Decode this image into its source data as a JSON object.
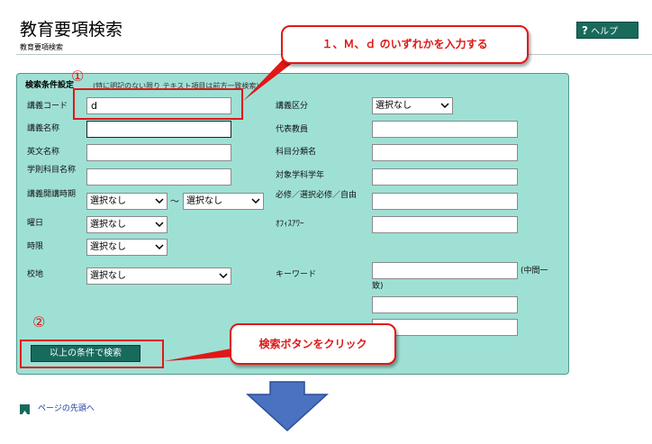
{
  "header": {
    "title": "教育要項検索",
    "subtitle": "教育要項検索",
    "help_label": "ヘルプ",
    "help_mark": "?"
  },
  "form": {
    "heading": "検索条件設定",
    "heading_note": "(特に明記のない限り テキスト項目は前方一致検索)",
    "left": {
      "code_label": "講義コード",
      "code_value": "d",
      "name_label": "講義名称",
      "english_label": "英文名称",
      "subject_label": "学則科目名称",
      "term_label": "講義開講時期",
      "term_from": "選択なし",
      "term_sep": "～",
      "term_to": "選択なし",
      "day_label": "曜日",
      "day_value": "選択なし",
      "period_label": "時限",
      "period_value": "選択なし",
      "campus_label": "校地",
      "campus_value": "選択なし"
    },
    "right": {
      "category_label": "講義区分",
      "category_value": "選択なし",
      "teacher_label": "代表教員",
      "classification_label": "科目分類名",
      "target_label": "対象学科学年",
      "required_label": "必修／選択必修／自由",
      "office_label": "ｵﾌｨｽｱﾜｰ",
      "keyword_label": "キーワード",
      "keyword_note_1": "(中間一",
      "keyword_note_2": "致)"
    },
    "search_button": "以上の条件で検索"
  },
  "annotations": {
    "marker_1": "①",
    "marker_2": "②",
    "callout_1": "１、Ｍ、ｄ のいずれかを入力する",
    "callout_2": "検索ボタンをクリック"
  },
  "footer": {
    "page_top_link": "ページの先頭へ"
  },
  "colors": {
    "panel_bg": "#9fe0d5",
    "button_bg": "#186a5c",
    "annotation_red": "#e01818",
    "arrow_blue": "#4a72c0"
  }
}
